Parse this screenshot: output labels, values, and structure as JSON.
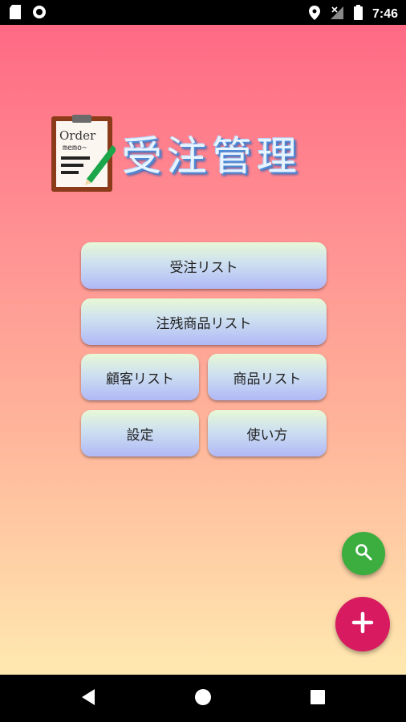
{
  "status_bar": {
    "time": "7:46",
    "icons": [
      "sd-card-icon",
      "circle-notification-icon",
      "location-icon",
      "signal-off-icon",
      "battery-icon"
    ]
  },
  "app": {
    "logo_text_line1": "Order",
    "logo_text_line2": "memo~",
    "title": "受注管理"
  },
  "menu": {
    "order_list": "受注リスト",
    "backorder_list": "注残商品リスト",
    "customer_list": "顧客リスト",
    "product_list": "商品リスト",
    "settings": "設定",
    "how_to_use": "使い方"
  },
  "fab": {
    "search_icon": "search-icon",
    "add_icon": "plus-icon",
    "search_color": "#3cae3f",
    "add_color": "#d81b60"
  },
  "nav_bar": {
    "icons": [
      "back-icon",
      "home-icon",
      "recents-icon"
    ]
  }
}
